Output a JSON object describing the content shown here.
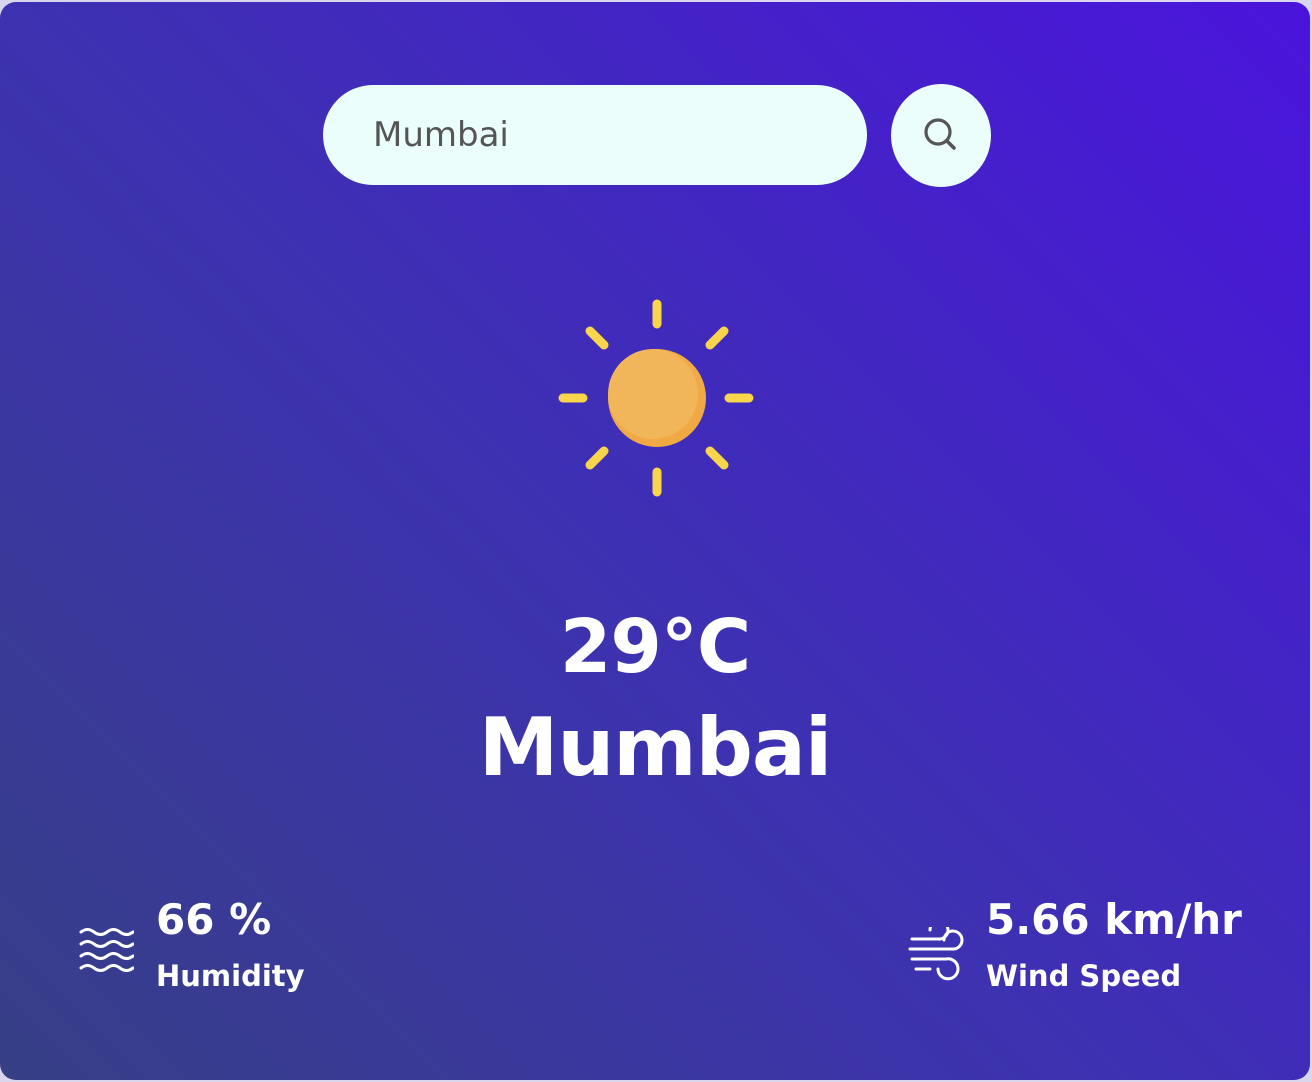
{
  "search": {
    "value": "Mumbai",
    "button_icon": "search-icon"
  },
  "weather": {
    "icon": "sun-icon",
    "temperature": "29°C",
    "city": "Mumbai"
  },
  "humidity": {
    "icon": "humidity-waves-icon",
    "value": "66 %",
    "label": "Humidity"
  },
  "wind": {
    "icon": "wind-icon",
    "value": "5.66 km/hr",
    "label": "Wind Speed"
  },
  "colors": {
    "gradient_start": "#373f86",
    "gradient_end": "#4a14dc",
    "input_background": "#ebfefc",
    "sun_core": "#f2b65a",
    "sun_rays": "#f8d54a"
  }
}
